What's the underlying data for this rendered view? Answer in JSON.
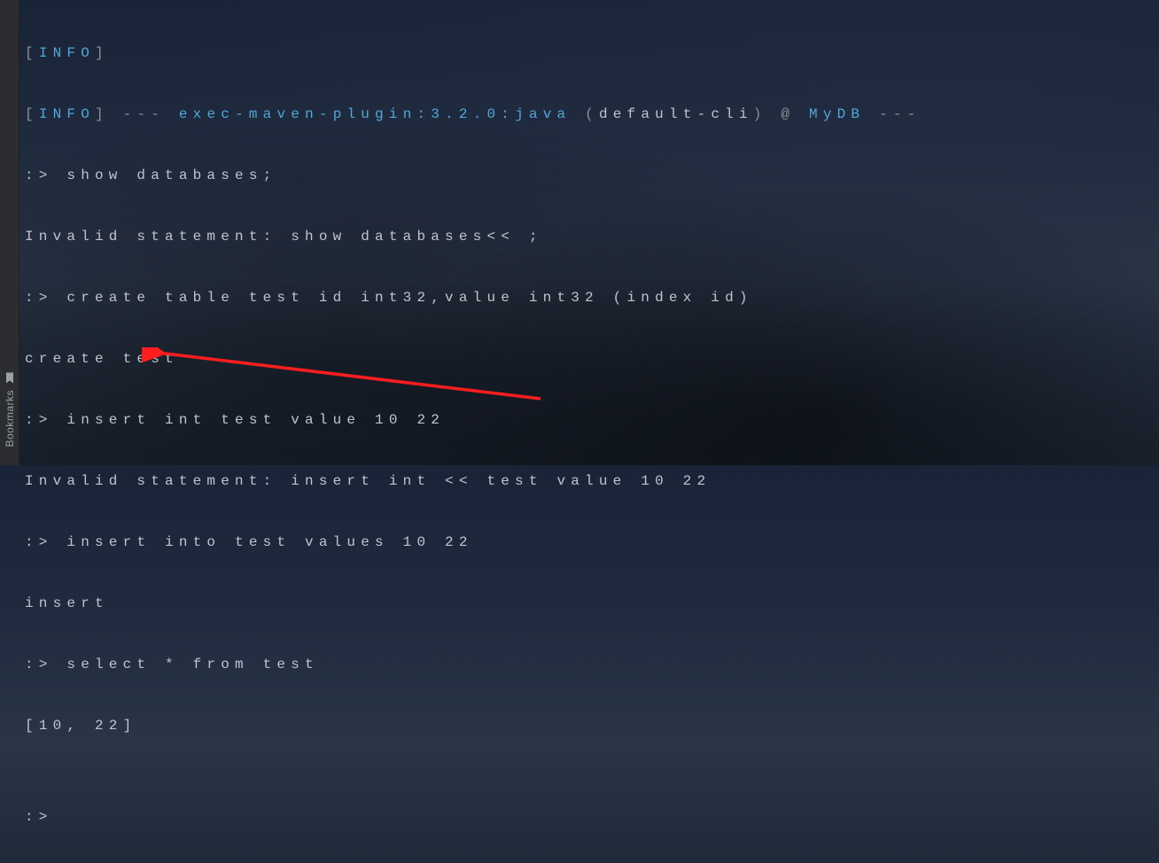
{
  "sidebar": {
    "bookmarks_label": "Bookmarks"
  },
  "log": {
    "level": "INFO",
    "brL": "[",
    "brR": "]",
    "dashes": "---",
    "goal": "exec-maven-plugin:3.2.0:java",
    "paren_l": "(",
    "paren_r": ")",
    "profile": "default-cli",
    "at": "@",
    "project": "MyDB"
  },
  "lines": {
    "l3": ":> show databases;",
    "l4": "Invalid statement: show databases<< ;",
    "l5": ":> create table test id int32,value int32 (index id)",
    "l6": "create test",
    "l7": ":> insert int test value 10 22",
    "l8": "Invalid statement: insert int << test value 10 22",
    "l9": ":> insert into test values 10 22",
    "l10": "insert",
    "l11": ":> select * from test",
    "l12": "[10, 22]",
    "l13": "",
    "l14": ":> "
  }
}
